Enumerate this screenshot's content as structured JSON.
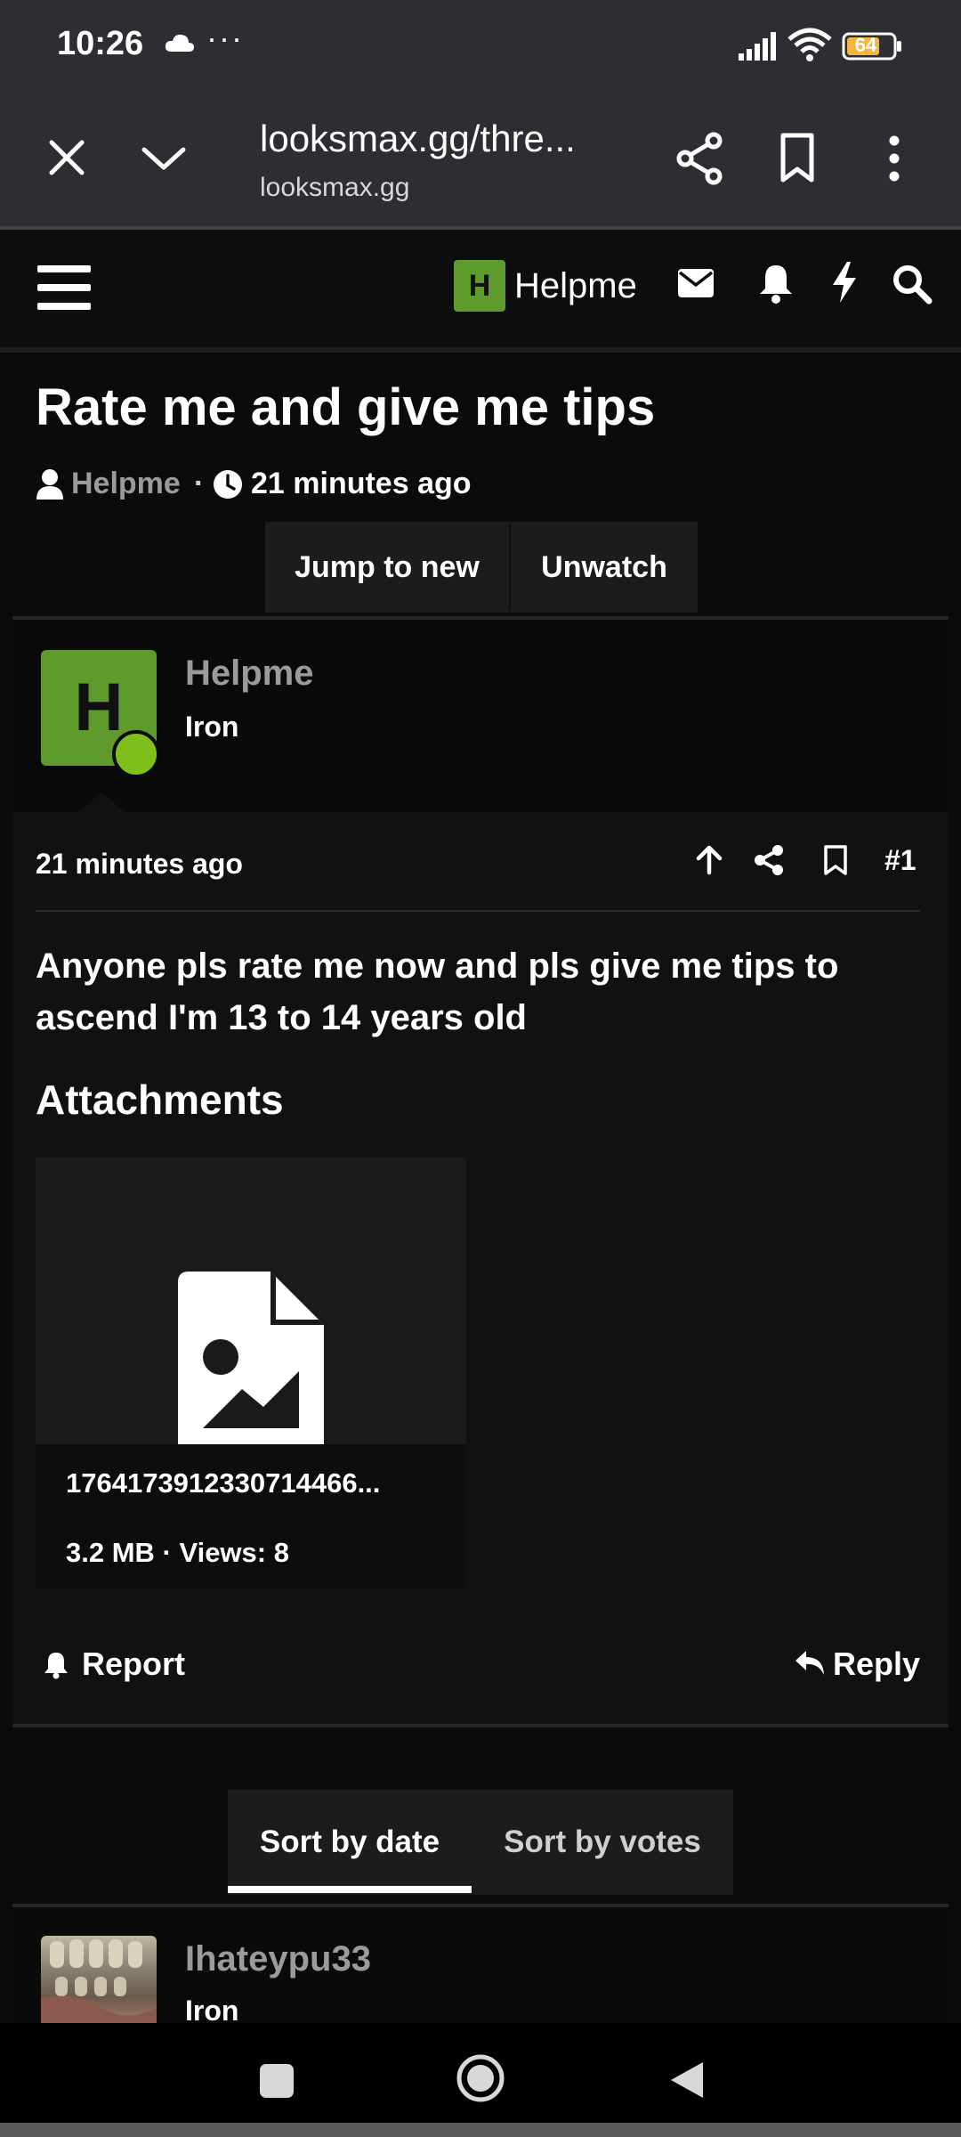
{
  "status_bar": {
    "time": "10:26",
    "more": "···",
    "battery": "64",
    "icons": [
      "cloud-icon",
      "signal-icon",
      "wifi-icon",
      "battery-icon"
    ]
  },
  "browser": {
    "url": "looksmax.gg/thre...",
    "domain": "looksmax.gg",
    "icons": [
      "close-icon",
      "chevron-down-icon",
      "share-icon",
      "bookmark-icon",
      "more-vert-icon"
    ]
  },
  "site_header": {
    "avatar_letter": "H",
    "username": "Helpme",
    "icons": [
      "menu-icon",
      "mail-icon",
      "bell-icon",
      "bolt-icon",
      "search-icon"
    ]
  },
  "thread": {
    "title": "Rate me and give me tips",
    "author": "Helpme",
    "separator": "·",
    "time": "21 minutes ago",
    "jump_label": "Jump to new",
    "unwatch_label": "Unwatch"
  },
  "post": {
    "avatar_letter": "H",
    "username": "Helpme",
    "rank": "Iron",
    "time": "21 minutes ago",
    "number": "#1",
    "body": "Anyone pls rate me now and pls give me tips to ascend I'm 13 to 14 years old",
    "attachments_title": "Attachments",
    "attachment": {
      "filename": "1764173912330714466...",
      "meta": "3.2 MB · Views: 8"
    },
    "report_label": "Report",
    "reply_label": "Reply"
  },
  "sort": {
    "by_date": "Sort by date",
    "by_votes": "Sort by votes",
    "active": "by_date"
  },
  "reply_post": {
    "username": "Ihateypu33",
    "rank": "Iron"
  },
  "colors": {
    "background": "#0b0b0b",
    "chrome": "#2d2e32",
    "avatar_green": "#5f9b2c",
    "online_green": "#7fbf1b",
    "muted_text": "#9b9b9b"
  }
}
